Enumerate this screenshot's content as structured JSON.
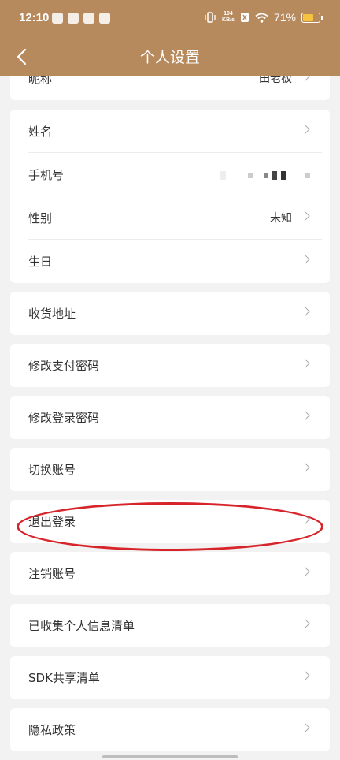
{
  "status_bar": {
    "time": "12:10",
    "speed_value": "104",
    "speed_unit": "KB/s",
    "battery": "71%",
    "battery_level": 0.71
  },
  "header": {
    "title": "个人设置"
  },
  "groups": [
    {
      "items": [
        {
          "label": "昵称",
          "value": "田老板"
        }
      ]
    },
    {
      "items": [
        {
          "label": "姓名",
          "value": ""
        },
        {
          "label": "手机号",
          "value": ""
        },
        {
          "label": "性别",
          "value": "未知"
        },
        {
          "label": "生日",
          "value": ""
        }
      ]
    },
    {
      "items": [
        {
          "label": "收货地址"
        }
      ]
    },
    {
      "items": [
        {
          "label": "修改支付密码"
        }
      ]
    },
    {
      "items": [
        {
          "label": "修改登录密码"
        }
      ]
    },
    {
      "items": [
        {
          "label": "切换账号"
        }
      ]
    },
    {
      "items": [
        {
          "label": "退出登录"
        }
      ]
    },
    {
      "items": [
        {
          "label": "注销账号"
        }
      ]
    },
    {
      "items": [
        {
          "label": "已收集个人信息清单"
        }
      ]
    },
    {
      "items": [
        {
          "label": "SDK共享清单"
        }
      ]
    },
    {
      "items": [
        {
          "label": "隐私政策"
        }
      ]
    }
  ],
  "colors": {
    "header": "#b78a5e",
    "annotation": "#d7242a"
  }
}
